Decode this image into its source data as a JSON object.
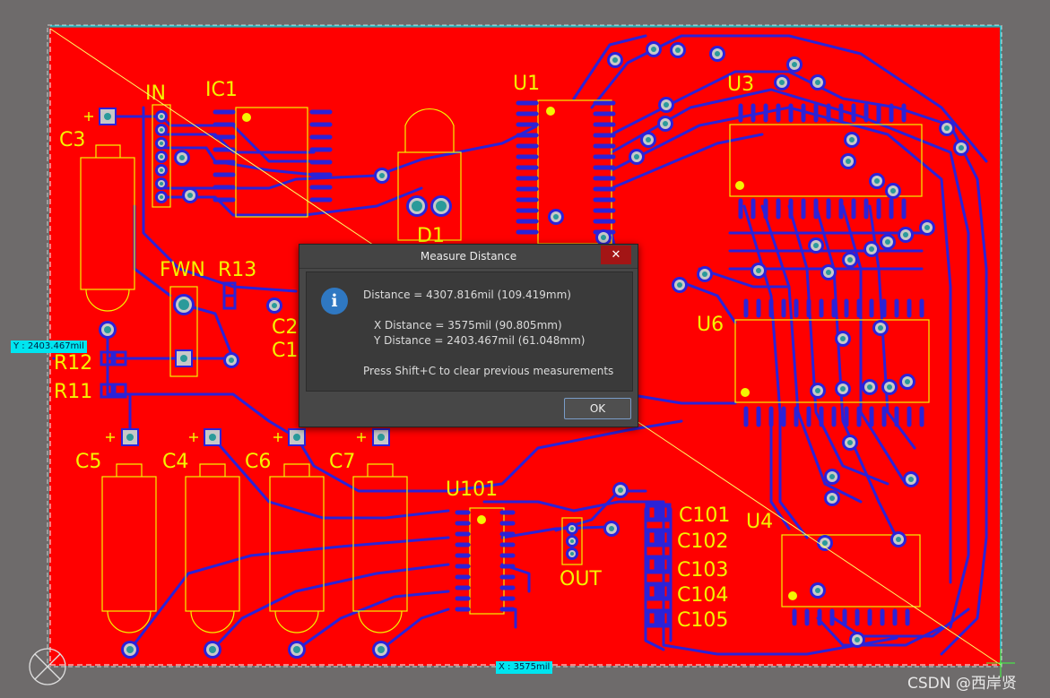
{
  "board": {
    "colors": {
      "background": "#6e6b6b",
      "copper": "#ff0000",
      "trace": "#2b22d8",
      "silkscreen": "#f4f400",
      "pad": "#2a9a9a",
      "measure_line": "#ffff66",
      "measure_tag": "#00e5f0"
    },
    "designators": [
      "IN",
      "IC1",
      "U1",
      "U3",
      "C3",
      "FWN",
      "R13",
      "D1",
      "C2",
      "C1",
      "R12",
      "R11",
      "U6",
      "C5",
      "C4",
      "C6",
      "C7",
      "U101",
      "C101",
      "C102",
      "C103",
      "C104",
      "C105",
      "U4",
      "OUT"
    ]
  },
  "measure": {
    "y_tag": "Y : 2403.467mil",
    "x_tag": "X : 3575mil"
  },
  "dialog": {
    "title": "Measure Distance",
    "close_glyph": "✕",
    "icon_glyph": "i",
    "distance": "Distance = 4307.816mil (109.419mm)",
    "x_distance": "X Distance = 3575mil (90.805mm)",
    "y_distance": "Y Distance = 2403.467mil (61.048mm)",
    "hint": "Press Shift+C to clear previous measurements",
    "ok_label": "OK"
  },
  "watermark": "CSDN @西岸贤",
  "icons": {
    "origin": "origin-marker-icon",
    "info": "info-icon",
    "close": "close-icon"
  }
}
